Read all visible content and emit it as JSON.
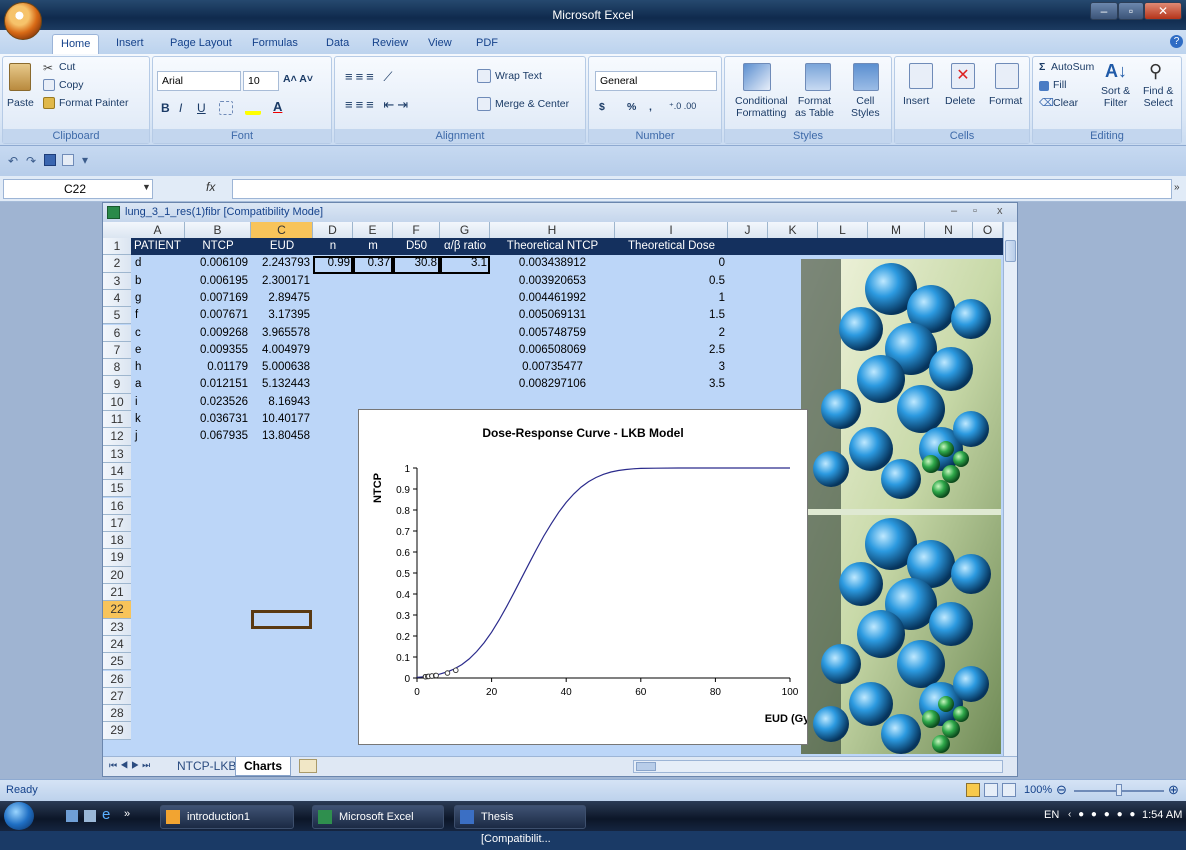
{
  "window": {
    "title": "Microsoft Excel"
  },
  "tabs": [
    "Home",
    "Insert",
    "Page Layout",
    "Formulas",
    "Data",
    "Review",
    "View",
    "PDF"
  ],
  "ribbon": {
    "clipboard": {
      "paste": "Paste",
      "cut": "Cut",
      "copy": "Copy",
      "format_painter": "Format Painter",
      "label": "Clipboard"
    },
    "font": {
      "name": "Arial",
      "size": "10",
      "label": "Font",
      "bold": "B",
      "italic": "I",
      "underline": "U"
    },
    "alignment": {
      "wrap": "Wrap Text",
      "merge": "Merge & Center",
      "label": "Alignment"
    },
    "number": {
      "format": "General",
      "currency": "$",
      "percent": "%",
      "comma": ",",
      "label": "Number"
    },
    "styles": {
      "conditional_1": "Conditional",
      "conditional_2": "Formatting",
      "format_table_1": "Format",
      "format_table_2": "as Table",
      "cell_styles_1": "Cell",
      "cell_styles_2": "Styles",
      "label": "Styles"
    },
    "cells": {
      "insert": "Insert",
      "delete": "Delete",
      "format": "Format",
      "label": "Cells"
    },
    "editing": {
      "autosum": "AutoSum",
      "fill": "Fill",
      "clear": "Clear",
      "sort_1": "Sort &",
      "sort_2": "Filter",
      "find_1": "Find &",
      "find_2": "Select",
      "label": "Editing"
    }
  },
  "formula_bar": {
    "name_box": "C22",
    "fx": "fx",
    "value": ""
  },
  "workbook": {
    "title": "lung_3_1_res(1)fibr  [Compatibility Mode]",
    "columns": [
      "A",
      "B",
      "C",
      "D",
      "E",
      "F",
      "G",
      "H",
      "I",
      "J",
      "K",
      "L",
      "M",
      "N",
      "O"
    ],
    "rows": [
      "1",
      "2",
      "3",
      "4",
      "5",
      "6",
      "7",
      "8",
      "9",
      "10",
      "11",
      "12",
      "13",
      "14",
      "15",
      "16",
      "17",
      "18",
      "19",
      "20",
      "21",
      "22",
      "23",
      "24",
      "25",
      "26",
      "27",
      "28",
      "29"
    ],
    "header": [
      "PATIENT",
      "NTCP",
      "EUD",
      "n",
      "m",
      "D50",
      "α/β ratio",
      "Theoretical NTCP",
      "Theoretical Dose"
    ],
    "data": [
      {
        "patient": "d",
        "ntcp": "0.006109",
        "eud": "2.243793",
        "n": "0.99",
        "m": "0.37",
        "d50": "30.8",
        "ab": "3.1",
        "tntcp": "0.003438912",
        "tdose": "0"
      },
      {
        "patient": "b",
        "ntcp": "0.006195",
        "eud": "2.300171",
        "tntcp": "0.003920653",
        "tdose": "0.5"
      },
      {
        "patient": "g",
        "ntcp": "0.007169",
        "eud": "2.89475",
        "tntcp": "0.004461992",
        "tdose": "1"
      },
      {
        "patient": "f",
        "ntcp": "0.007671",
        "eud": "3.17395",
        "tntcp": "0.005069131",
        "tdose": "1.5"
      },
      {
        "patient": "c",
        "ntcp": "0.009268",
        "eud": "3.965578",
        "tntcp": "0.005748759",
        "tdose": "2"
      },
      {
        "patient": "e",
        "ntcp": "0.009355",
        "eud": "4.004979",
        "tntcp": "0.006508069",
        "tdose": "2.5"
      },
      {
        "patient": "h",
        "ntcp": "0.01179",
        "eud": "5.000638",
        "tntcp": "0.00735477",
        "tdose": "3"
      },
      {
        "patient": "a",
        "ntcp": "0.012151",
        "eud": "5.132443",
        "tntcp": "0.008297106",
        "tdose": "3.5"
      },
      {
        "patient": "i",
        "ntcp": "0.023526",
        "eud": "8.16943"
      },
      {
        "patient": "k",
        "ntcp": "0.036731",
        "eud": "10.40177"
      },
      {
        "patient": "j",
        "ntcp": "0.067935",
        "eud": "13.80458"
      }
    ],
    "sheets": [
      "NTCP-LKB",
      "Charts"
    ],
    "active_sheet": "Charts"
  },
  "chart_data": {
    "type": "scatter",
    "title": "Dose-Response Curve - LKB Model",
    "xlabel": "EUD (Gy)",
    "ylabel": "NTCP",
    "xlim": [
      0,
      100
    ],
    "ylim": [
      0,
      1
    ],
    "xticks": [
      0,
      20,
      40,
      60,
      80,
      100
    ],
    "yticks": [
      0,
      0.1,
      0.2,
      0.3,
      0.4,
      0.5,
      0.6,
      0.7,
      0.8,
      0.9,
      1
    ],
    "series": [
      {
        "style": "line",
        "x": [
          0,
          2,
          4,
          6,
          8,
          10,
          12,
          14,
          16,
          18,
          20,
          22,
          24,
          26,
          28,
          30,
          32,
          34,
          36,
          38,
          40,
          42,
          44,
          46,
          48,
          50,
          52,
          54,
          56,
          58,
          60,
          64,
          70,
          80,
          90,
          100
        ],
        "y": [
          0.0034,
          0.0063,
          0.0109,
          0.018,
          0.0286,
          0.0435,
          0.064,
          0.091,
          0.126,
          0.168,
          0.218,
          0.276,
          0.339,
          0.406,
          0.475,
          0.544,
          0.612,
          0.676,
          0.735,
          0.789,
          0.836,
          0.876,
          0.909,
          0.935,
          0.955,
          0.97,
          0.981,
          0.988,
          0.993,
          0.996,
          0.998,
          0.999,
          1.0,
          1.0,
          1.0,
          1.0
        ]
      },
      {
        "style": "points",
        "x": [
          2.243793,
          2.300171,
          2.89475,
          3.17395,
          3.965578,
          4.004979,
          5.000638,
          5.132443,
          8.16943,
          10.40177
        ],
        "y": [
          0.006109,
          0.006195,
          0.007169,
          0.007671,
          0.009268,
          0.009355,
          0.01179,
          0.012151,
          0.023526,
          0.036731
        ]
      }
    ]
  },
  "status": {
    "ready": "Ready",
    "zoom": "100%"
  },
  "taskbar": {
    "items": [
      "introduction1",
      "Microsoft Excel",
      "Thesis [Compatibilit..."
    ],
    "lang": "EN",
    "time": "1:54 AM"
  }
}
